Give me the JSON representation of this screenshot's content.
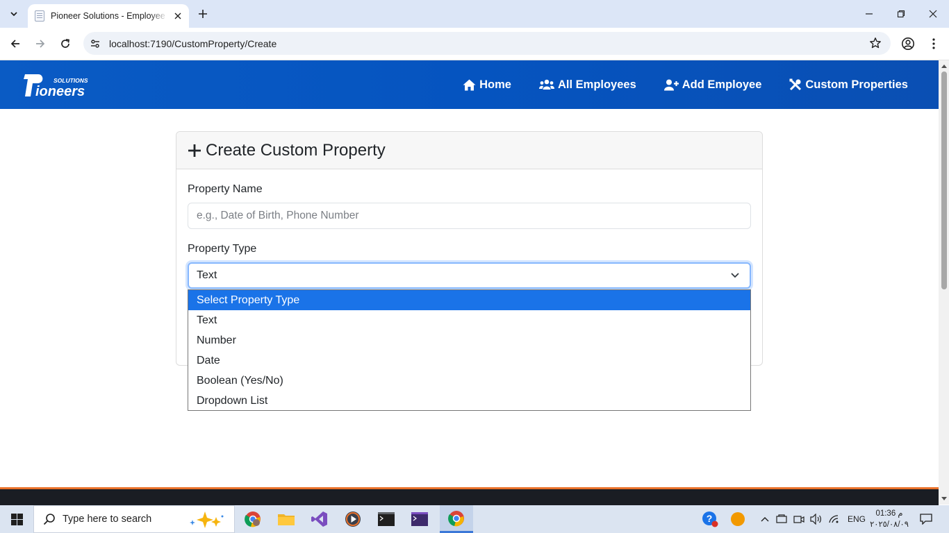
{
  "browser": {
    "tab_title": "Pioneer Solutions - Employee Management",
    "url": "localhost:7190/CustomProperty/Create"
  },
  "navbar": {
    "brand": "Pioneers Solutions",
    "links": [
      {
        "label": "Home",
        "icon": "home-icon"
      },
      {
        "label": "All Employees",
        "icon": "users-icon"
      },
      {
        "label": "Add Employee",
        "icon": "user-plus-icon"
      },
      {
        "label": "Custom Properties",
        "icon": "tools-icon"
      }
    ]
  },
  "card": {
    "title": "Create Custom Property",
    "property_name_label": "Property Name",
    "property_name_placeholder": "e.g., Date of Birth, Phone Number",
    "property_type_label": "Property Type",
    "property_type_value": "Text"
  },
  "dropdown": {
    "options": [
      "Select Property Type",
      "Text",
      "Number",
      "Date",
      "Boolean (Yes/No)",
      "Dropdown List"
    ],
    "highlighted": "Select Property Type"
  },
  "taskbar": {
    "search_placeholder": "Type here to search",
    "language": "ENG",
    "time": "01:36 م",
    "date": "٢٠٢٥/٠٨/٠٩"
  },
  "colors": {
    "navbar": "#0554c0",
    "footer_accent": "#e9702a",
    "selected_option": "#1a73e8"
  }
}
